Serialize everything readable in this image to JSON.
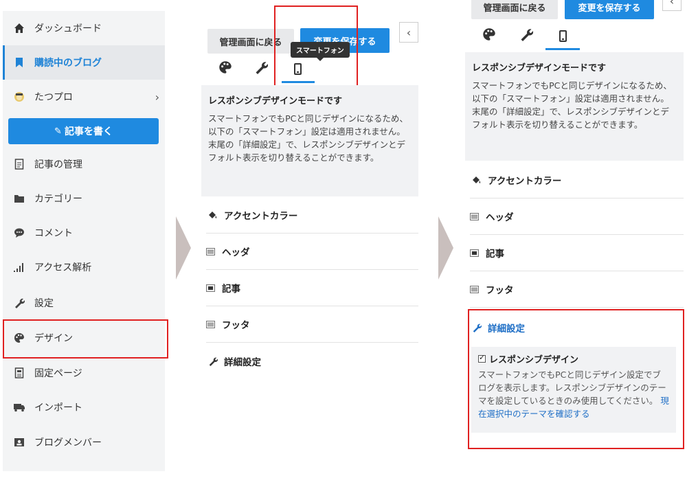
{
  "sidebar": {
    "items": [
      {
        "label": "ダッシュボード",
        "icon": "home-icon"
      },
      {
        "label": "購読中のブログ",
        "icon": "bookmark-icon"
      },
      {
        "label": "たつプロ",
        "icon": "blog-avatar-icon"
      },
      {
        "label": "記事の管理",
        "icon": "document-icon"
      },
      {
        "label": "カテゴリー",
        "icon": "folder-icon"
      },
      {
        "label": "コメント",
        "icon": "comment-icon"
      },
      {
        "label": "アクセス解析",
        "icon": "bar-chart-icon"
      },
      {
        "label": "設定",
        "icon": "wrench-icon"
      },
      {
        "label": "デザイン",
        "icon": "palette-icon"
      },
      {
        "label": "固定ページ",
        "icon": "page-icon"
      },
      {
        "label": "インポート",
        "icon": "import-icon"
      },
      {
        "label": "ブログメンバー",
        "icon": "members-icon"
      }
    ],
    "write_button": "記事を書く"
  },
  "editor_before": {
    "back_label": "管理画面に戻る",
    "save_label": "変更を保存する",
    "tooltip": "スマートフォン",
    "info_title": "レスポンシブデザインモードです",
    "info_text": "スマートフォンでもPCと同じデザインになるため、以下の「スマートフォン」設定は適用されません。末尾の「詳細設定」で、レスポンシブデザインとデフォルト表示を切り替えることができます。",
    "sections": [
      "アクセントカラー",
      "ヘッダ",
      "記事",
      "フッタ",
      "詳細設定"
    ]
  },
  "editor_after": {
    "back_label": "管理画面に戻る",
    "save_label": "変更を保存する",
    "info_title": "レスポンシブデザインモードです",
    "info_text": "スマートフォンでもPCと同じデザインになるため、以下の「スマートフォン」設定は適用されません。末尾の「詳細設定」で、レスポンシブデザインとデフォルト表示を切り替えることができます。",
    "sections": [
      "アクセントカラー",
      "ヘッダ",
      "記事",
      "フッタ"
    ],
    "detail_title": "詳細設定",
    "detail_checkbox_label": "レスポンシブデザイン",
    "detail_text": "スマートフォンでもPCと同じデザイン設定でブログを表示します。レスポンシブデザインのテーマを設定しているときのみ使用してください。",
    "detail_link": "現在選択中のテーマを確認する"
  },
  "colors": {
    "accent": "#1f8ae0",
    "highlight": "#e02020",
    "sidebar_bg": "#f3f4f5"
  }
}
